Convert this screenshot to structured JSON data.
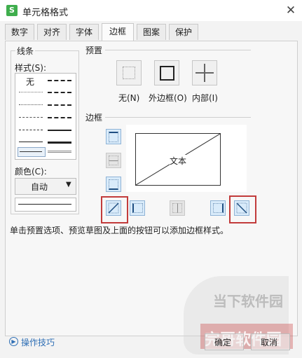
{
  "window": {
    "title": "单元格格式",
    "app_icon": "S"
  },
  "tabs": [
    "数字",
    "对齐",
    "字体",
    "边框",
    "图案",
    "保护"
  ],
  "line_section": {
    "title": "线条",
    "style_label": "样式(S):",
    "none_label": "无",
    "color_label": "颜色(C):",
    "color_value": "自动"
  },
  "preset": {
    "title": "预置",
    "none_label": "无(N)",
    "outline_label": "外边框(O)",
    "inside_label": "内部(I)"
  },
  "border": {
    "title": "边框",
    "preview_text": "文本"
  },
  "hint": "单击预置选项、预览草图及上面的按钮可以添加边框样式。",
  "tips_link": "操作技巧",
  "buttons": {
    "ok": "确定",
    "cancel": "取消"
  },
  "watermark": {
    "line1": "当下软件园",
    "line2": "完哥软件园"
  },
  "colors": {
    "accent_red": "#c23b3b",
    "button_blue": "#d9ebfa"
  }
}
